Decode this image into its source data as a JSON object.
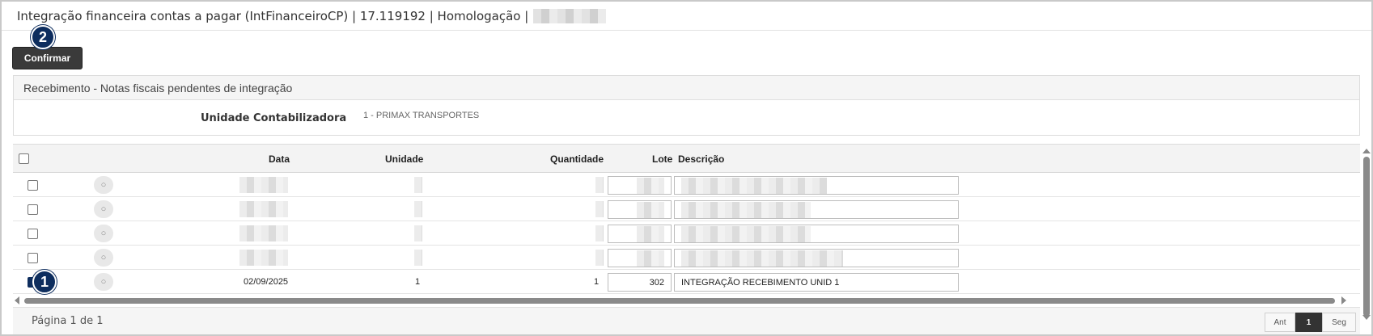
{
  "window": {
    "title": "Integração financeira contas a pagar (IntFinanceiroCP) | 17.119192 | Homologação |"
  },
  "toolbar": {
    "confirm_label": "Confirmar"
  },
  "badges": {
    "confirm_step": "2",
    "row_step": "1"
  },
  "panel": {
    "title": "Recebimento - Notas fiscais pendentes de integração",
    "field_label": "Unidade Contabilizadora",
    "field_value": "1 - PRIMAX TRANSPORTES"
  },
  "grid": {
    "columns": {
      "data": "Data",
      "unidade": "Unidade",
      "quantidade": "Quantidade",
      "lote": "Lote",
      "descricao": "Descrição"
    },
    "rows": [
      {
        "checked": false,
        "data": "",
        "unidade": "",
        "quantidade": "",
        "lote": "",
        "descricao": ""
      },
      {
        "checked": false,
        "data": "",
        "unidade": "",
        "quantidade": "",
        "lote": "",
        "descricao": ""
      },
      {
        "checked": false,
        "data": "",
        "unidade": "",
        "quantidade": "",
        "lote": "",
        "descricao": ""
      },
      {
        "checked": false,
        "data": "",
        "unidade": "",
        "quantidade": "",
        "lote": "",
        "descricao": ""
      },
      {
        "checked": true,
        "data": "02/09/2025",
        "unidade": "1",
        "quantidade": "1",
        "lote": "302",
        "descricao": "INTEGRAÇÃO RECEBIMENTO UNID 1"
      }
    ]
  },
  "footer": {
    "page_info": "Página 1 de 1",
    "prev_label": "Ant",
    "current_page": "1",
    "next_label": "Seg"
  },
  "icons": {
    "row_view": "search-icon"
  },
  "colors": {
    "accent": "#0d2d5e",
    "button_bg": "#3a3a3a"
  }
}
